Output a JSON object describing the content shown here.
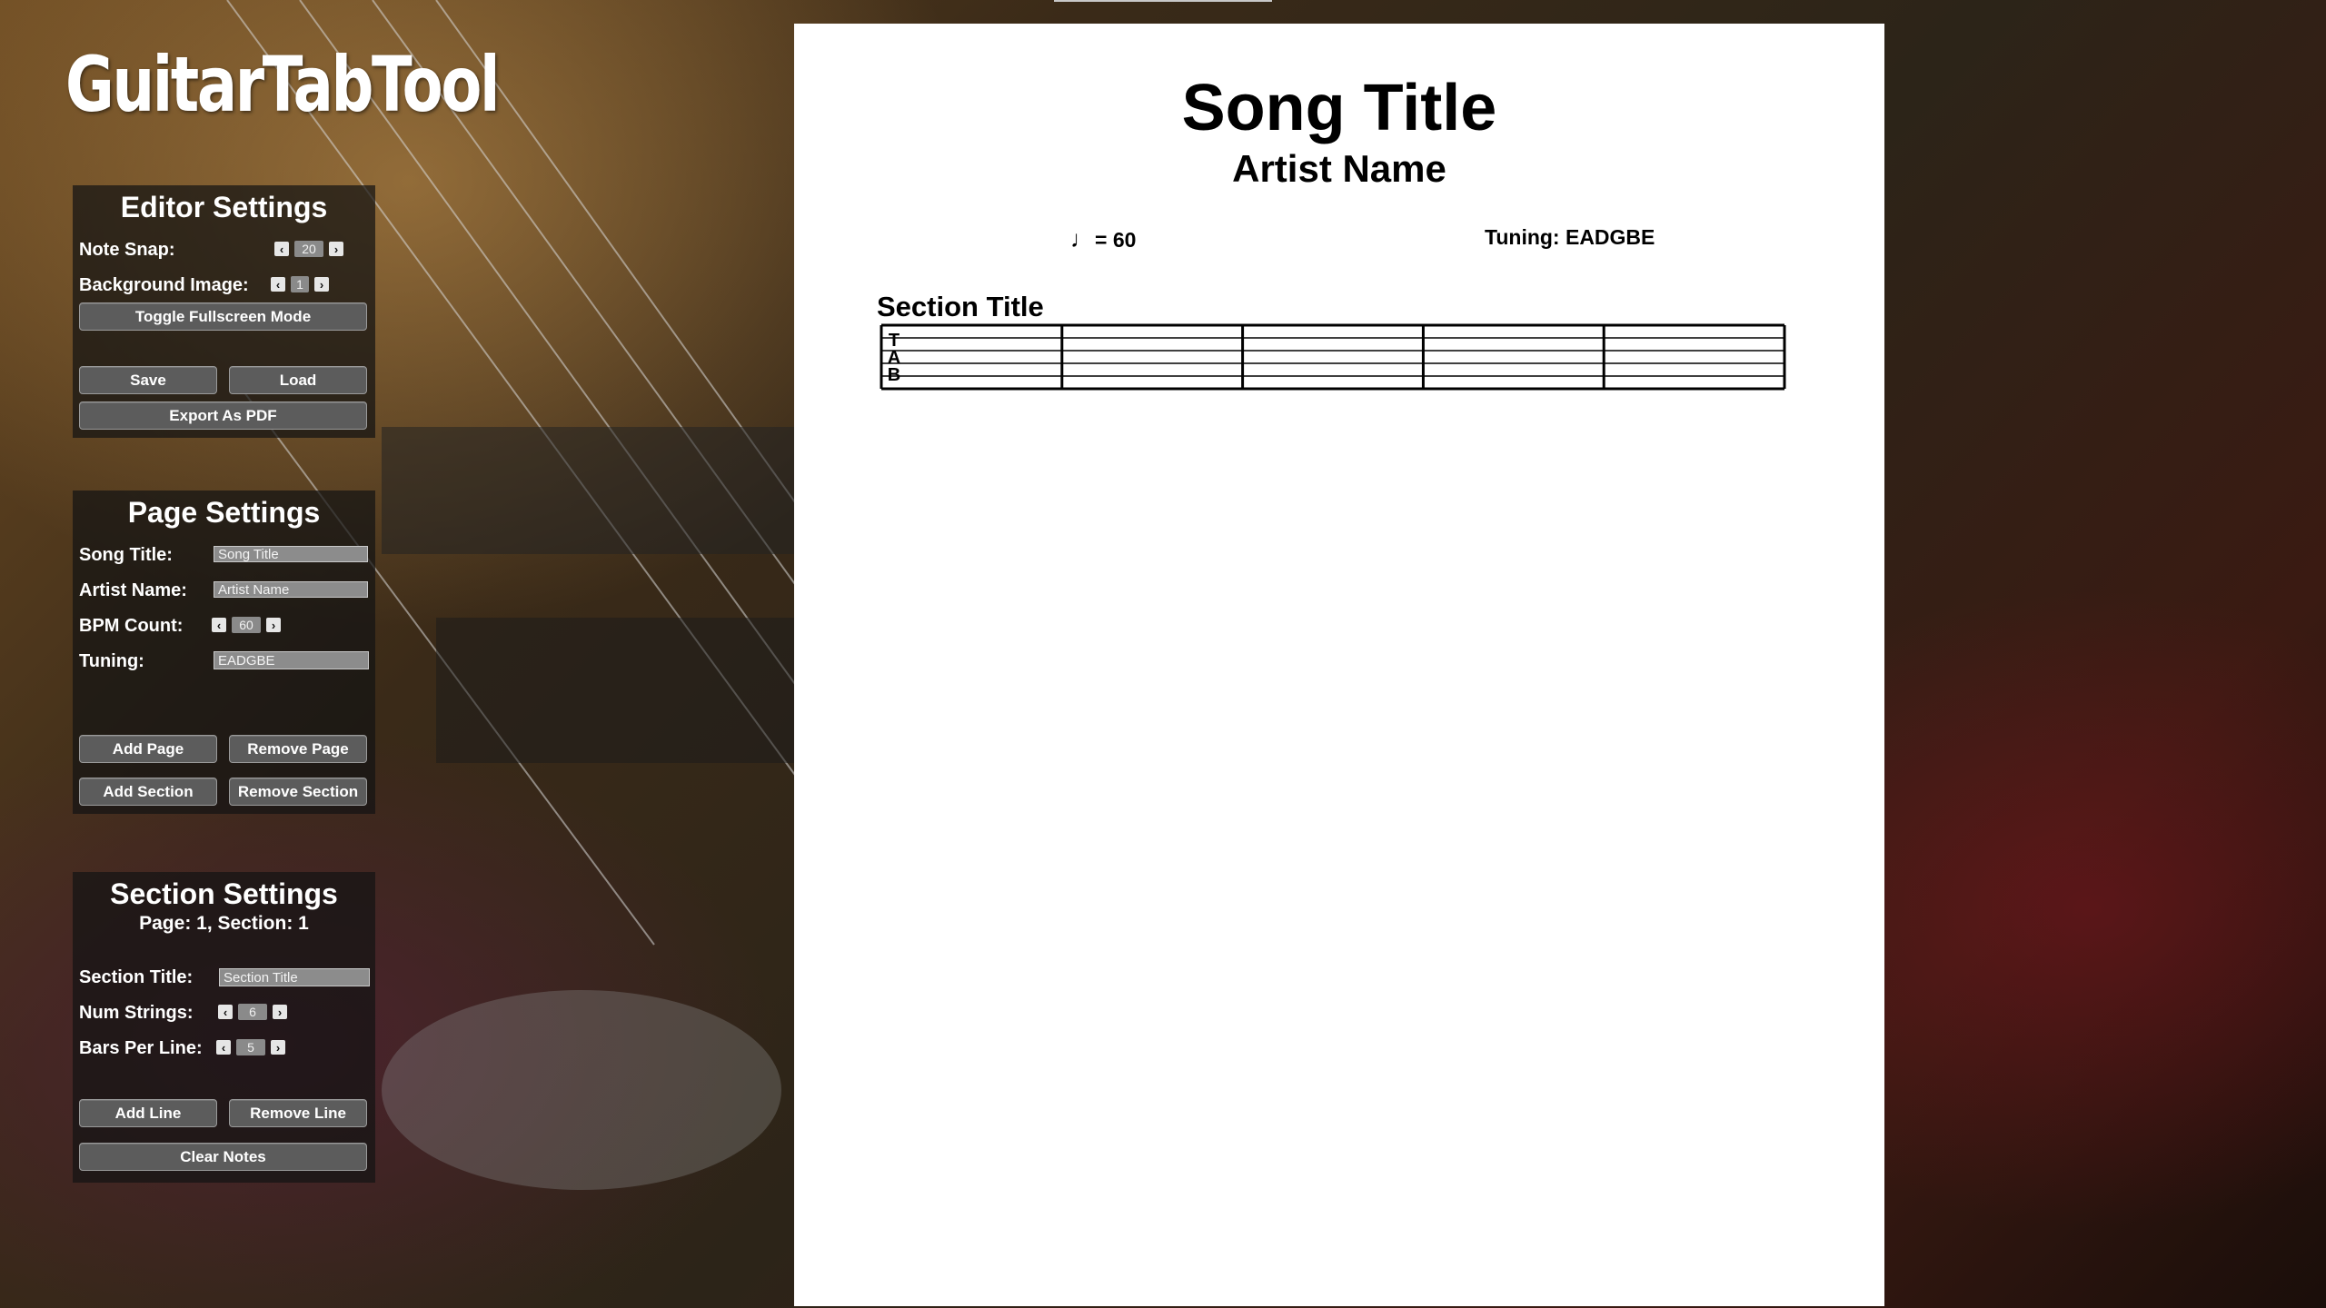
{
  "app": {
    "logo": "GuitarTabTool"
  },
  "editor_settings": {
    "title": "Editor Settings",
    "note_snap_label": "Note Snap:",
    "note_snap_value": "20",
    "background_image_label": "Background Image:",
    "background_image_value": "1",
    "toggle_fullscreen": "Toggle Fullscreen Mode",
    "save": "Save",
    "load": "Load",
    "export_pdf": "Export As PDF"
  },
  "page_settings": {
    "title": "Page Settings",
    "song_title_label": "Song Title:",
    "song_title_value": "Song Title",
    "artist_name_label": "Artist Name:",
    "artist_name_value": "Artist Name",
    "bpm_label": "BPM Count:",
    "bpm_value": "60",
    "tuning_label": "Tuning:",
    "tuning_value": "EADGBE",
    "add_page": "Add Page",
    "remove_page": "Remove Page",
    "add_section": "Add Section",
    "remove_section": "Remove Section"
  },
  "section_settings": {
    "title": "Section Settings",
    "location": "Page: 1, Section: 1",
    "section_title_label": "Section Title:",
    "section_title_value": "Section Title",
    "num_strings_label": "Num Strings:",
    "num_strings_value": "6",
    "bars_per_line_label": "Bars Per Line:",
    "bars_per_line_value": "5",
    "add_line": "Add Line",
    "remove_line": "Remove Line",
    "clear_notes": "Clear Notes"
  },
  "sheet": {
    "song_title": "Song Title",
    "artist": "Artist Name",
    "tempo_note": "♩",
    "tempo_text": "= 60",
    "tuning_text": "Tuning: EADGBE",
    "section_title": "Section Title",
    "tab_letters": [
      "T",
      "A",
      "B"
    ],
    "num_strings": 6,
    "bars_per_line": 5
  },
  "icons": {
    "decrement": "chevron-left-icon",
    "increment": "chevron-right-icon"
  }
}
